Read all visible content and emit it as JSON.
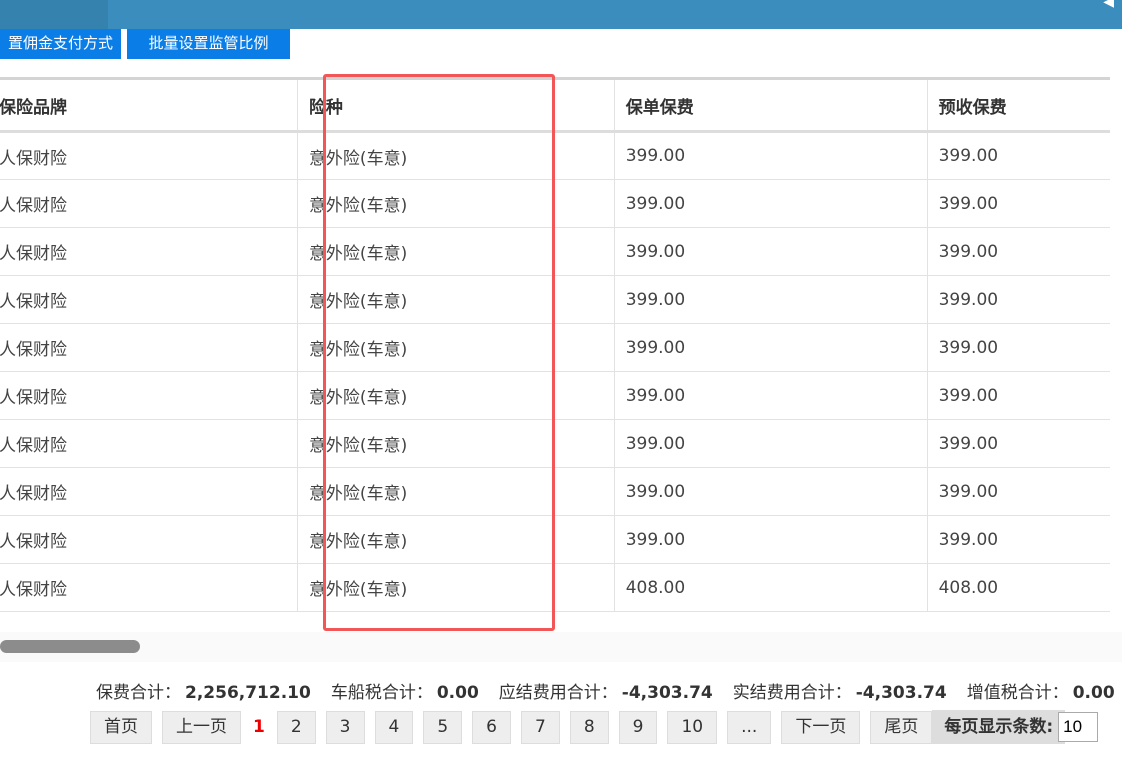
{
  "toolbar": {
    "btn1": "置佣金支付方式",
    "btn2": "批量设置监管比例"
  },
  "table": {
    "headers": [
      "保险品牌",
      "险种",
      "保单保费",
      "预收保费"
    ],
    "rows": [
      [
        "人保财险",
        "意外险(车意)",
        "399.00",
        "399.00"
      ],
      [
        "人保财险",
        "意外险(车意)",
        "399.00",
        "399.00"
      ],
      [
        "人保财险",
        "意外险(车意)",
        "399.00",
        "399.00"
      ],
      [
        "人保财险",
        "意外险(车意)",
        "399.00",
        "399.00"
      ],
      [
        "人保财险",
        "意外险(车意)",
        "399.00",
        "399.00"
      ],
      [
        "人保财险",
        "意外险(车意)",
        "399.00",
        "399.00"
      ],
      [
        "人保财险",
        "意外险(车意)",
        "399.00",
        "399.00"
      ],
      [
        "人保财险",
        "意外险(车意)",
        "399.00",
        "399.00"
      ],
      [
        "人保财险",
        "意外险(车意)",
        "399.00",
        "399.00"
      ],
      [
        "人保财险",
        "意外险(车意)",
        "408.00",
        "408.00"
      ]
    ]
  },
  "summary": [
    {
      "label": "保费合计：",
      "value": "2,256,712.10"
    },
    {
      "label": "车船税合计：",
      "value": "0.00"
    },
    {
      "label": "应结费用合计：",
      "value": "-4,303.74"
    },
    {
      "label": "实结费用合计：",
      "value": "-4,303.74"
    },
    {
      "label": "增值税合计：",
      "value": "0.00"
    }
  ],
  "pager": {
    "first": "首页",
    "prev": "上一页",
    "current": "1",
    "pages": [
      "2",
      "3",
      "4",
      "5",
      "6",
      "7",
      "8",
      "9",
      "10",
      "..."
    ],
    "next": "下一页",
    "last": "尾页",
    "per_page_label": "每页显示条数:",
    "per_page_value": "10"
  },
  "colors": {
    "highlight": "#f25656",
    "button": "#0a7ee6",
    "topbar": "#3a8dbd"
  }
}
